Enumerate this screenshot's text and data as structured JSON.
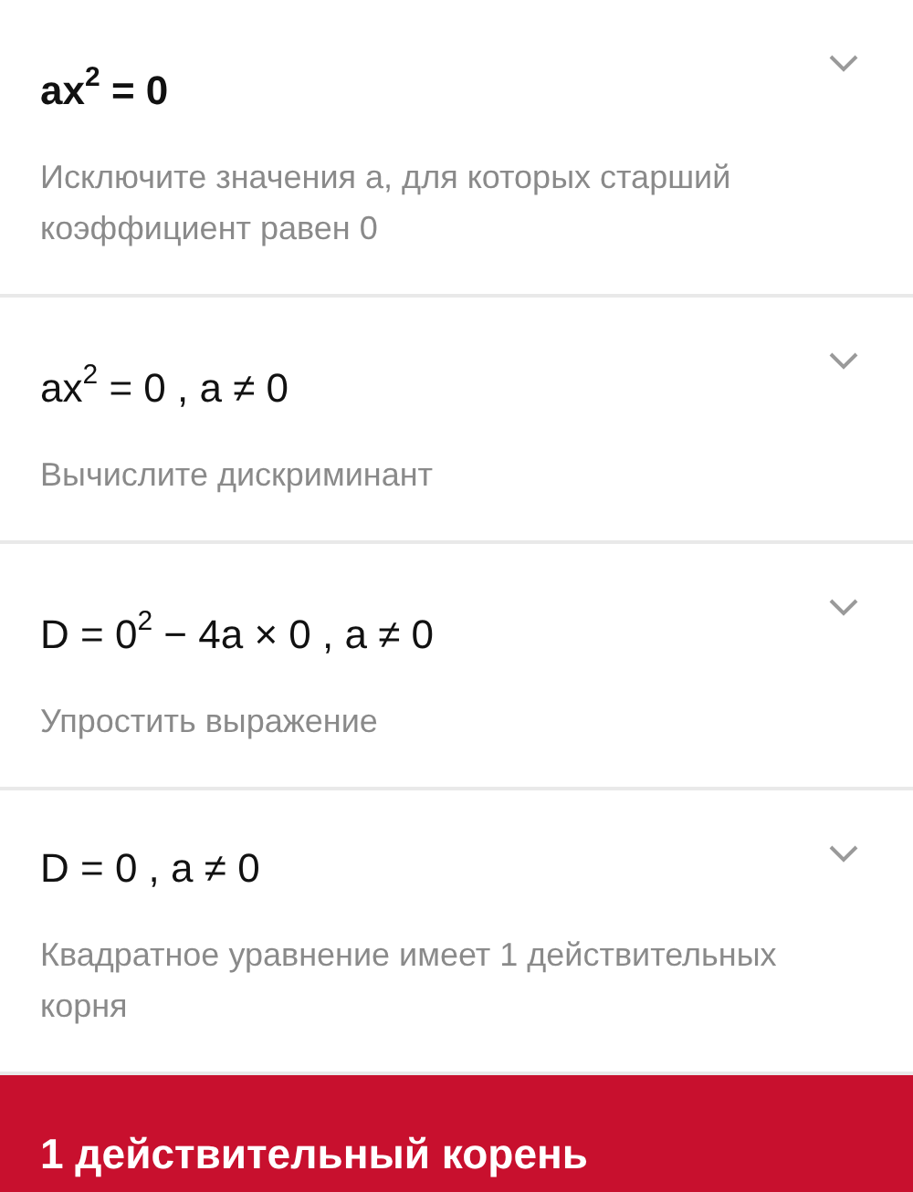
{
  "steps": [
    {
      "kind": "problem",
      "formula": "ax$^{2}$ = 0",
      "description": "Исключите значения a, для которых старший коэффициент равен 0",
      "expanded": false
    },
    {
      "kind": "step",
      "formula": "ax$^{2}$ = 0 , a ≠ 0",
      "description": "Вычислите дискриминант",
      "expanded": false
    },
    {
      "kind": "step",
      "formula": "D = 0$^{2}$ − 4a × 0 , a ≠ 0",
      "description": "Упростить выражение",
      "expanded": false
    },
    {
      "kind": "step",
      "formula": "D = 0 , a ≠ 0",
      "description": "Квадратное уравнение имеет 1 действительных корня",
      "expanded": false
    }
  ],
  "answer": "1 действительный корень"
}
